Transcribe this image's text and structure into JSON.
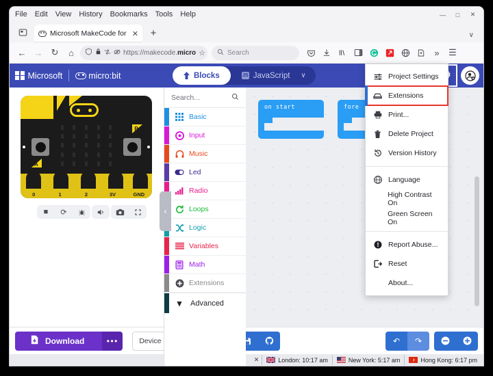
{
  "browser": {
    "menubar": [
      "File",
      "Edit",
      "View",
      "History",
      "Bookmarks",
      "Tools",
      "Help"
    ],
    "window_controls": {
      "minimize": "—",
      "maximize": "□",
      "close": "✕"
    },
    "tab": {
      "title": "Microsoft MakeCode for",
      "close": "✕",
      "favicon": "microbit-favicon"
    },
    "new_tab_label": "+",
    "list_all_tabs": "∨",
    "nav": {
      "back": "←",
      "forward": "→",
      "reload": "↻",
      "home": "⌂",
      "shield": "shield-icon",
      "lock": "lock-icon",
      "url_prefix": "https://makecode.",
      "url_host": "micro",
      "bookmark": "☆"
    },
    "search": {
      "placeholder": "Search",
      "icon": "search-icon"
    },
    "extensions": [
      "pocket-icon",
      "downloads-icon",
      "library-icon",
      "sidebar-icon",
      "grammarly-icon",
      "adblock-icon",
      "translate-icon",
      "save-to-pocket-icon",
      "overflow-icon",
      "app-menu-icon"
    ]
  },
  "app": {
    "header": {
      "microsoft": "Microsoft",
      "product": "micro:bit",
      "toggle": {
        "blocks": "Blocks",
        "javascript": "JavaScript",
        "caret": "∨"
      },
      "icons": {
        "home": "home-icon",
        "share": "share-icon",
        "help": "help-icon",
        "settings": "gear-icon",
        "account": "account-icon"
      }
    },
    "simulator": {
      "pins": [
        "0",
        "1",
        "2",
        "3V",
        "GND"
      ],
      "button_a": "A",
      "button_b": "B",
      "controls": [
        "stop-icon",
        "restart-icon",
        "debug-icon",
        "mute-icon",
        "screenshot-icon",
        "fullscreen-icon"
      ],
      "collapse": "‹"
    },
    "toolbox": {
      "search_placeholder": "Search...",
      "search_icon": "search-icon",
      "items": [
        {
          "label": "Basic",
          "color": "#1e90e0",
          "text": "#1e90e0",
          "icon": "grid-icon"
        },
        {
          "label": "Input",
          "color": "#d819d8",
          "text": "#d819d8",
          "icon": "circle-dot-icon"
        },
        {
          "label": "Music",
          "color": "#e8491c",
          "text": "#e8491c",
          "icon": "headphones-icon"
        },
        {
          "label": "Led",
          "color": "#5b3ba8",
          "text": "#3a2a8f",
          "icon": "toggle-icon"
        },
        {
          "label": "Radio",
          "color": "#e81c8e",
          "text": "#e81c8e",
          "icon": "bars-icon"
        },
        {
          "label": "Loops",
          "color": "#1bbd3a",
          "text": "#1bbd3a",
          "icon": "loop-icon"
        },
        {
          "label": "Logic",
          "color": "#11a0a8",
          "text": "#11a0a8",
          "icon": "shuffle-icon"
        },
        {
          "label": "Variables",
          "color": "#e8254a",
          "text": "#e8254a",
          "icon": "lines-icon"
        },
        {
          "label": "Math",
          "color": "#9b20e8",
          "text": "#9b20e8",
          "icon": "calculator-icon"
        },
        {
          "label": "Extensions",
          "color": "#8a8a8a",
          "text": "#8a8a8a",
          "icon": "plus-circle-icon"
        }
      ],
      "advanced": {
        "label": "Advanced",
        "caret": "⌄",
        "color": "#0f3b44"
      }
    },
    "workspace": {
      "blocks": [
        {
          "label": "on start"
        },
        {
          "label": "fore"
        }
      ]
    },
    "menu": {
      "items": [
        {
          "label": "Project Settings",
          "icon": "sliders-icon",
          "highlight": false
        },
        {
          "label": "Extensions",
          "icon": "extension-icon",
          "highlight": true
        },
        {
          "label": "Print...",
          "icon": "printer-icon",
          "highlight": false
        },
        {
          "label": "Delete Project",
          "icon": "trash-icon",
          "highlight": false
        },
        {
          "label": "Version History",
          "icon": "history-icon",
          "highlight": false
        },
        {
          "separator": true
        },
        {
          "label": "Language",
          "icon": "globe-icon",
          "highlight": false
        },
        {
          "label": "High Contrast On",
          "icon": "",
          "highlight": false
        },
        {
          "label": "Green Screen On",
          "icon": "",
          "highlight": false
        },
        {
          "separator": true
        },
        {
          "label": "Report Abuse...",
          "icon": "warning-icon",
          "highlight": false
        },
        {
          "label": "Reset",
          "icon": "reset-icon",
          "highlight": false
        },
        {
          "label": "About...",
          "icon": "",
          "highlight": false
        }
      ],
      "highlight_color": "#e8342a"
    },
    "bottom": {
      "download_label": "Download",
      "download_icon": "download-icon",
      "more_label": "•••",
      "device_id_placeholder": "Device ID",
      "save_icon": "save-icon",
      "github_icon": "github-icon",
      "undo_icon": "↶",
      "redo_icon": "↷",
      "zoom_out_icon": "−",
      "zoom_in_icon": "+"
    }
  },
  "statusbar": {
    "close": "✕",
    "clocks": [
      {
        "city": "London",
        "time": "10:17 am",
        "flag": "uk-flag"
      },
      {
        "city": "New York",
        "time": "5:17 am",
        "flag": "us-flag"
      },
      {
        "city": "Hong Kong",
        "time": "6:17 pm",
        "flag": "hk-flag"
      }
    ]
  }
}
